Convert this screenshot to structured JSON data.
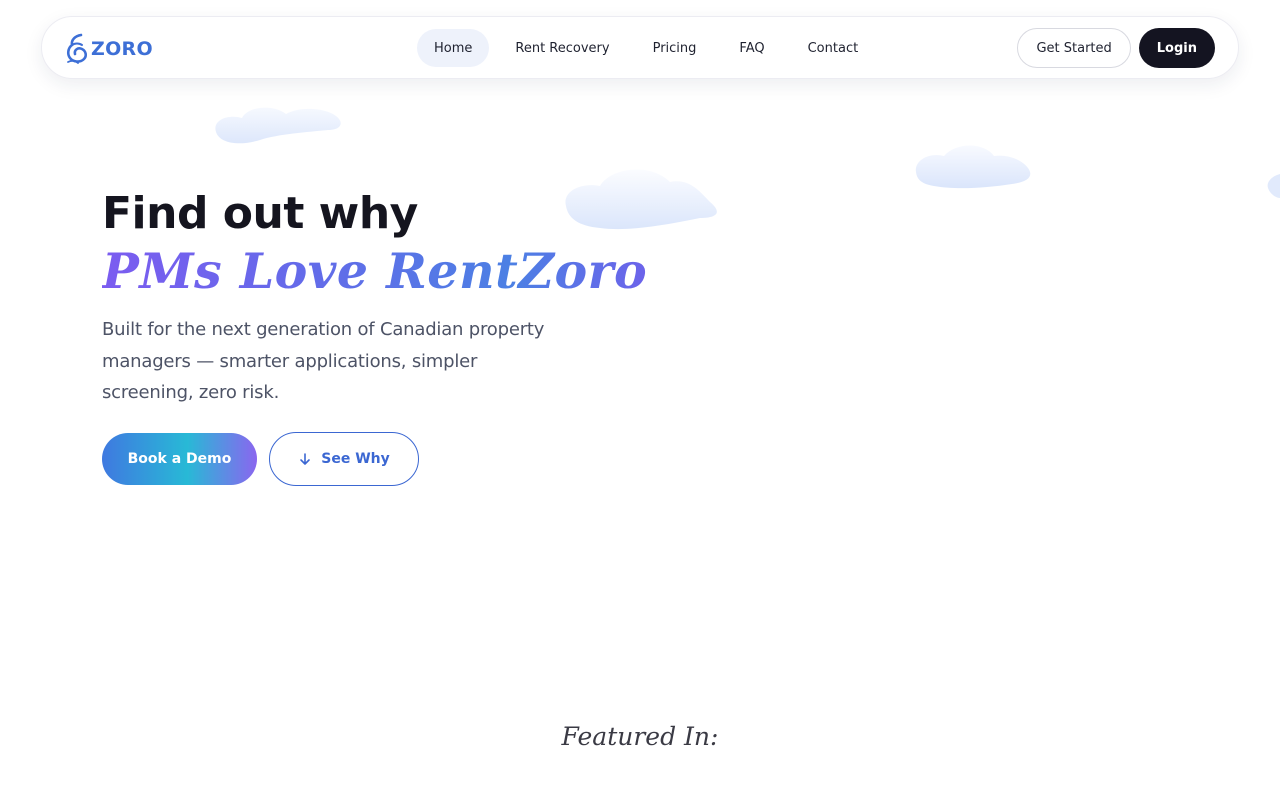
{
  "brand": {
    "name": "ZORO",
    "color": "#3d6fd6"
  },
  "nav": {
    "links": [
      {
        "label": "Home",
        "active": true
      },
      {
        "label": "Rent Recovery",
        "active": false
      },
      {
        "label": "Pricing",
        "active": false
      },
      {
        "label": "FAQ",
        "active": false
      },
      {
        "label": "Contact",
        "active": false
      }
    ],
    "get_started_label": "Get Started",
    "login_label": "Login"
  },
  "hero": {
    "title": "Find out why",
    "highlight": "PMs Love RentZoro",
    "subtitle": "Built for the next generation of Canadian property managers — smarter applications, simpler screening, zero risk.",
    "primary_cta": "Book a Demo",
    "secondary_cta": "See Why",
    "secondary_cta_icon": "arrow-down-icon"
  },
  "featured": {
    "heading": "Featured In:"
  },
  "colors": {
    "accent_blue": "#3b67d2",
    "dark_button": "#141421",
    "gradient_purple": "#7b5cf0",
    "gradient_teal": "#28b9d6",
    "cloud": "#e6eefc"
  }
}
